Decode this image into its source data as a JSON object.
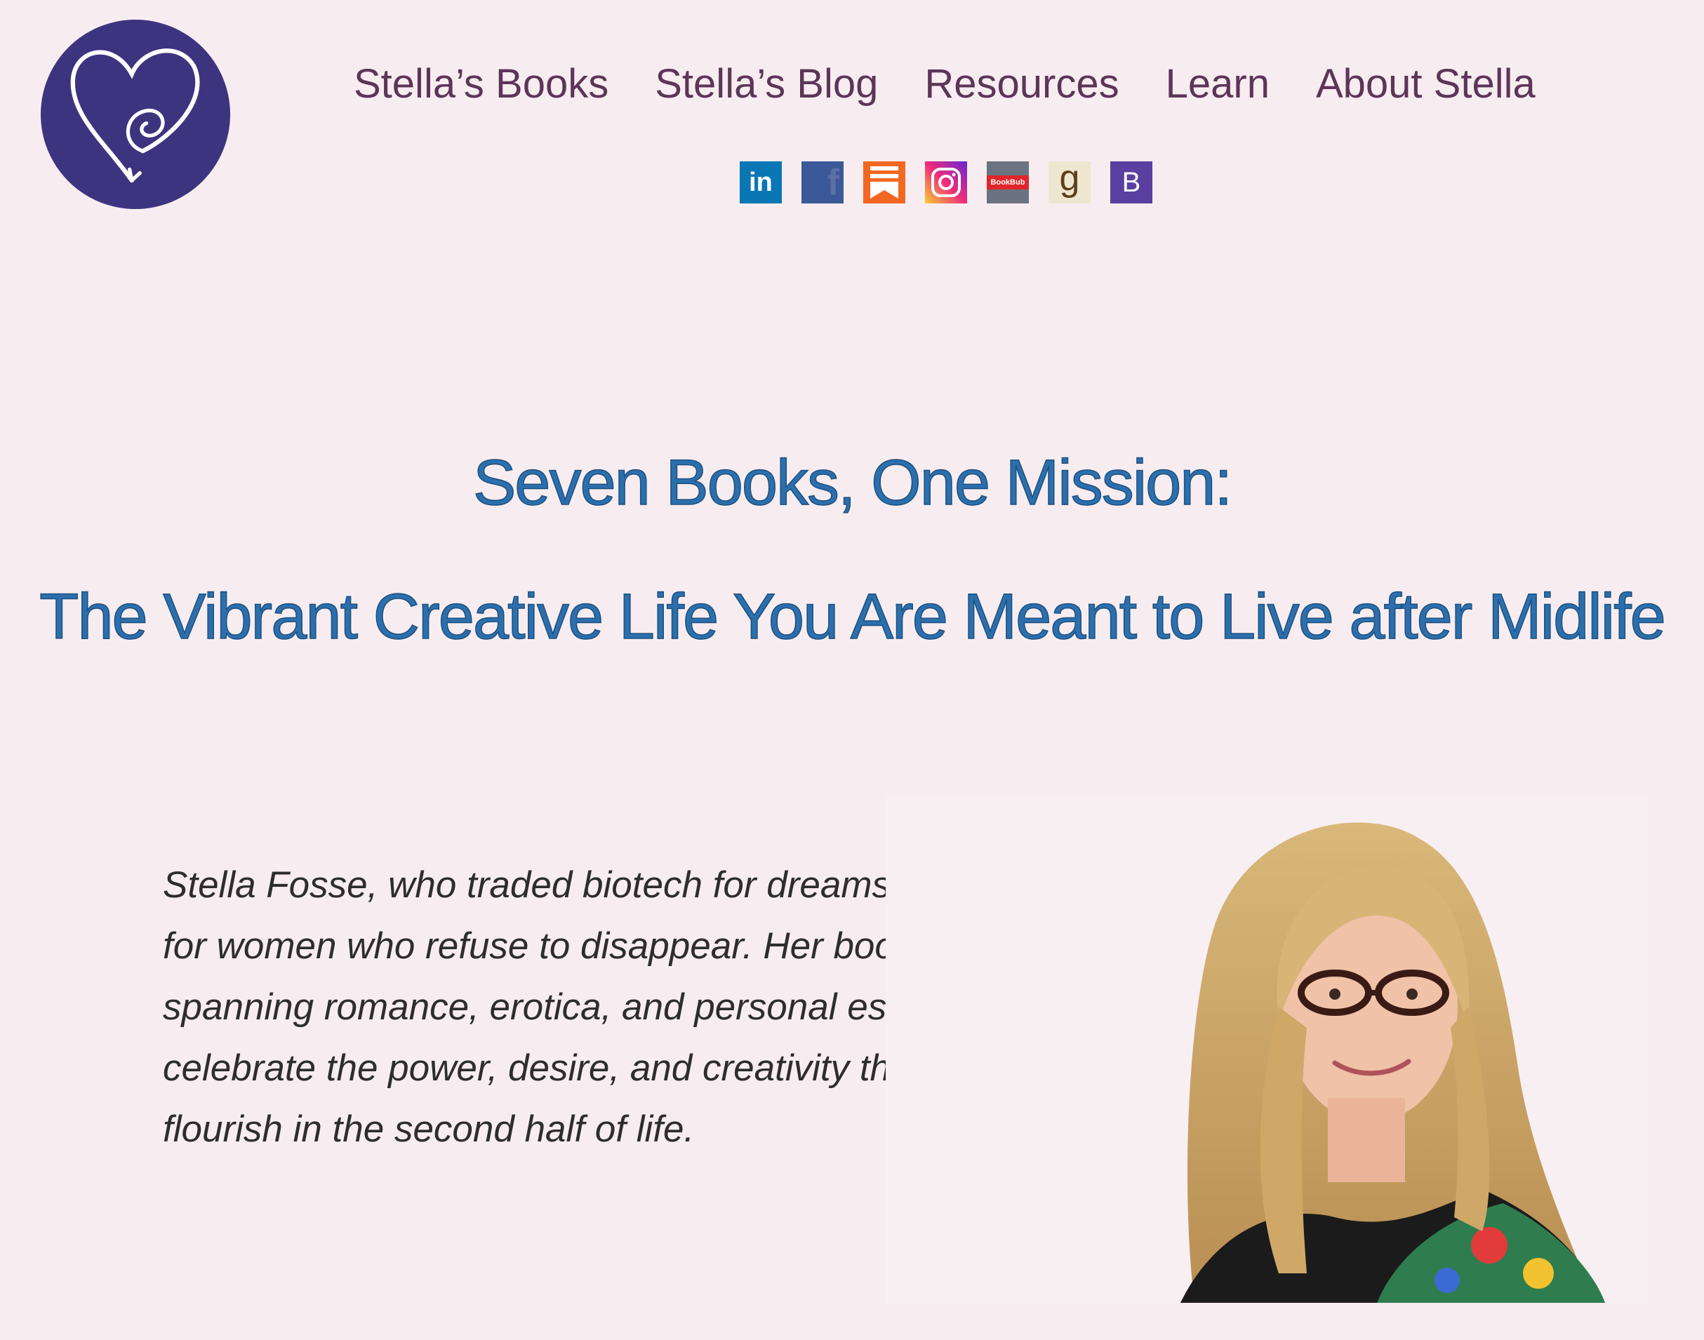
{
  "logo": {
    "alt": "Stella Fosse heart logo",
    "color": "#3d3480"
  },
  "nav": {
    "items": [
      {
        "label": "Stella’s Books"
      },
      {
        "label": "Stella’s Blog"
      },
      {
        "label": "Resources"
      },
      {
        "label": "Learn"
      },
      {
        "label": "About Stella"
      }
    ],
    "color": "#5c3558"
  },
  "social": {
    "items": [
      {
        "name": "linkedin-icon",
        "glyph": "in",
        "bg": "#0a77b5"
      },
      {
        "name": "facebook-icon",
        "glyph": "f",
        "bg": "#3b5998"
      },
      {
        "name": "substack-icon",
        "glyph": "",
        "bg": "#f26722"
      },
      {
        "name": "instagram-icon",
        "glyph": "",
        "bg": "#d6336c"
      },
      {
        "name": "bookbub-icon",
        "glyph": "BookBub",
        "bg": "#6b7280"
      },
      {
        "name": "goodreads-icon",
        "glyph": "g",
        "bg": "#eee6cf"
      },
      {
        "name": "bookshop-icon",
        "glyph": "B",
        "bg": "#5b3fa0"
      }
    ]
  },
  "hero": {
    "title_line1": "Seven Books, One Mission:",
    "title_line2": "The Vibrant Creative Life You Are Meant to Live after Midlife",
    "color": "#2b6fad"
  },
  "bio": {
    "text": "Stella Fosse, who traded biotech for dreams, writes for women who refuse to disappear. Her books — spanning romance, erotica, and personal essay — celebrate the power, desire, and creativity that flourish in the second half of life."
  },
  "photo": {
    "alt": "Portrait of Stella Fosse"
  }
}
